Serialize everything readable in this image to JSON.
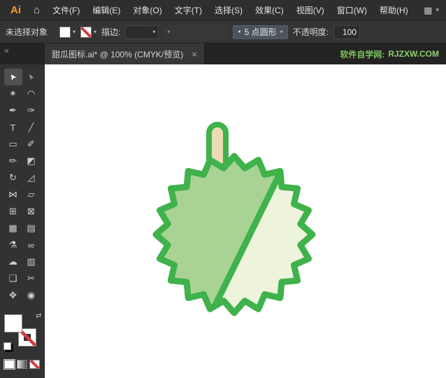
{
  "menu": {
    "logo": "Ai",
    "items": [
      "文件(F)",
      "编辑(E)",
      "对象(O)",
      "文字(T)",
      "选择(S)",
      "效果(C)",
      "视图(V)",
      "窗口(W)",
      "帮助(H)"
    ]
  },
  "icons": {
    "home": "⌂",
    "workspace": "▦",
    "chevron_down": "▾",
    "collapse": "«",
    "swap": "⇄",
    "bullet": "●"
  },
  "control": {
    "no_selection": "未选择对象",
    "stroke_label": "描边:",
    "brush_value": "5 点圆形",
    "opacity_label": "不透明度:",
    "opacity_value": "100"
  },
  "tab": {
    "title": "甜瓜图标.ai* @ 100% (CMYK/预览)",
    "close": "×",
    "credit_site": "软件自学网:",
    "credit_url": "RJZXW.COM"
  },
  "toolbar": {
    "tools": [
      {
        "name": "selection",
        "glyph": "➤",
        "active": true
      },
      {
        "name": "direct-selection",
        "glyph": "➢"
      },
      {
        "name": "magic-wand",
        "glyph": "✶"
      },
      {
        "name": "lasso",
        "glyph": "◠"
      },
      {
        "name": "pen",
        "glyph": "✒"
      },
      {
        "name": "curvature",
        "glyph": "✑"
      },
      {
        "name": "type",
        "glyph": "T"
      },
      {
        "name": "line-segment",
        "glyph": "╱"
      },
      {
        "name": "rectangle",
        "glyph": "▭"
      },
      {
        "name": "paintbrush",
        "glyph": "✐"
      },
      {
        "name": "pencil",
        "glyph": "✏"
      },
      {
        "name": "eraser",
        "glyph": "◩"
      },
      {
        "name": "rotate",
        "glyph": "↻"
      },
      {
        "name": "scale",
        "glyph": "◿"
      },
      {
        "name": "width",
        "glyph": "⋈"
      },
      {
        "name": "free-transform",
        "glyph": "▱"
      },
      {
        "name": "shape-builder",
        "glyph": "⊞"
      },
      {
        "name": "perspective-grid",
        "glyph": "⊠"
      },
      {
        "name": "mesh",
        "glyph": "▦"
      },
      {
        "name": "gradient",
        "glyph": "▤"
      },
      {
        "name": "eyedropper",
        "glyph": "⚗"
      },
      {
        "name": "blend",
        "glyph": "∞"
      },
      {
        "name": "symbol-sprayer",
        "glyph": "☁"
      },
      {
        "name": "column-graph",
        "glyph": "▥"
      },
      {
        "name": "artboard",
        "glyph": "❏"
      },
      {
        "name": "slice",
        "glyph": "✂"
      },
      {
        "name": "hand",
        "glyph": "✥"
      },
      {
        "name": "zoom",
        "glyph": "◉"
      }
    ]
  },
  "artwork": {
    "description": "melon icon with spiky outline, diagonal slice and stem",
    "outline": "#3fb24b",
    "body_fill": "#a9d394",
    "slice_fill": "#eef3dc",
    "stem_fill": "#ecdcb4",
    "canvas_bg": "#ffffff"
  }
}
